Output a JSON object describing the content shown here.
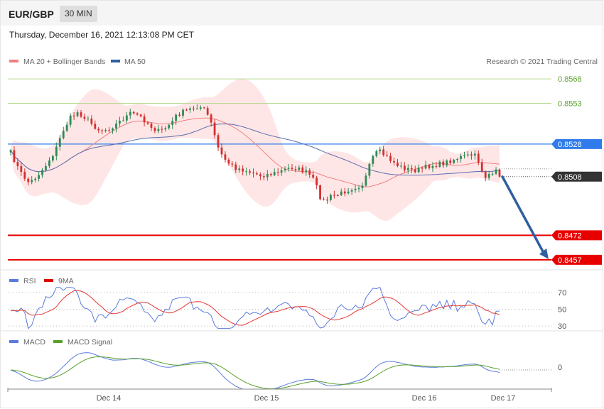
{
  "header": {
    "symbol": "EUR/GBP",
    "timeframe": "30 MIN",
    "datetime": "Thursday, December 16, 2021 12:13:08 PM CET"
  },
  "legend": {
    "ma20": "MA 20 + Bollinger Bands",
    "ma50": "MA 50",
    "rsi": "RSI",
    "rsi_ma": "9MA",
    "macd": "MACD",
    "macd_signal": "MACD Signal"
  },
  "copyright": "Research © 2021 Trading Central",
  "colors": {
    "up": "#2e8b57",
    "down": "#d32f2f",
    "ma20": "#f08080",
    "ma50": "#5a6db0",
    "band": "#ffe3e3",
    "resistance": "#2f7bea",
    "support": "#e80000",
    "target": "#7cb342",
    "last": "#333333",
    "arrow": "#2f5fa0",
    "rsi": "#5b7bdc",
    "rsi_ma": "#e53935",
    "macd": "#5b7bdc",
    "macd_signal": "#5aa02c"
  },
  "chart_data": [
    {
      "id": "price",
      "type": "candlestick",
      "ylim": [
        0.8453,
        0.8575
      ],
      "x_labels": [
        "Dec 14",
        "Dec 15",
        "Dec 16",
        "Dec 17"
      ],
      "levels": [
        {
          "label": "0.8568",
          "value": 0.8568,
          "kind": "target"
        },
        {
          "label": "0.8553",
          "value": 0.8553,
          "kind": "target"
        },
        {
          "label": "0.8528",
          "value": 0.8528,
          "kind": "resistance"
        },
        {
          "label": "0.8508",
          "value": 0.8508,
          "kind": "last"
        },
        {
          "label": "0.8472",
          "value": 0.8472,
          "kind": "support"
        },
        {
          "label": "0.8457",
          "value": 0.8457,
          "kind": "support"
        }
      ],
      "forecast": {
        "from": 0.8508,
        "to": 0.8457
      }
    },
    {
      "id": "rsi",
      "type": "line",
      "ylim": [
        25,
        80
      ],
      "ticks": [
        {
          "label": "70",
          "value": 70
        },
        {
          "label": "50",
          "value": 50
        },
        {
          "label": "30",
          "value": 30
        }
      ]
    },
    {
      "id": "macd",
      "type": "line",
      "ticks": [
        {
          "label": "0",
          "value": 0
        }
      ]
    }
  ]
}
